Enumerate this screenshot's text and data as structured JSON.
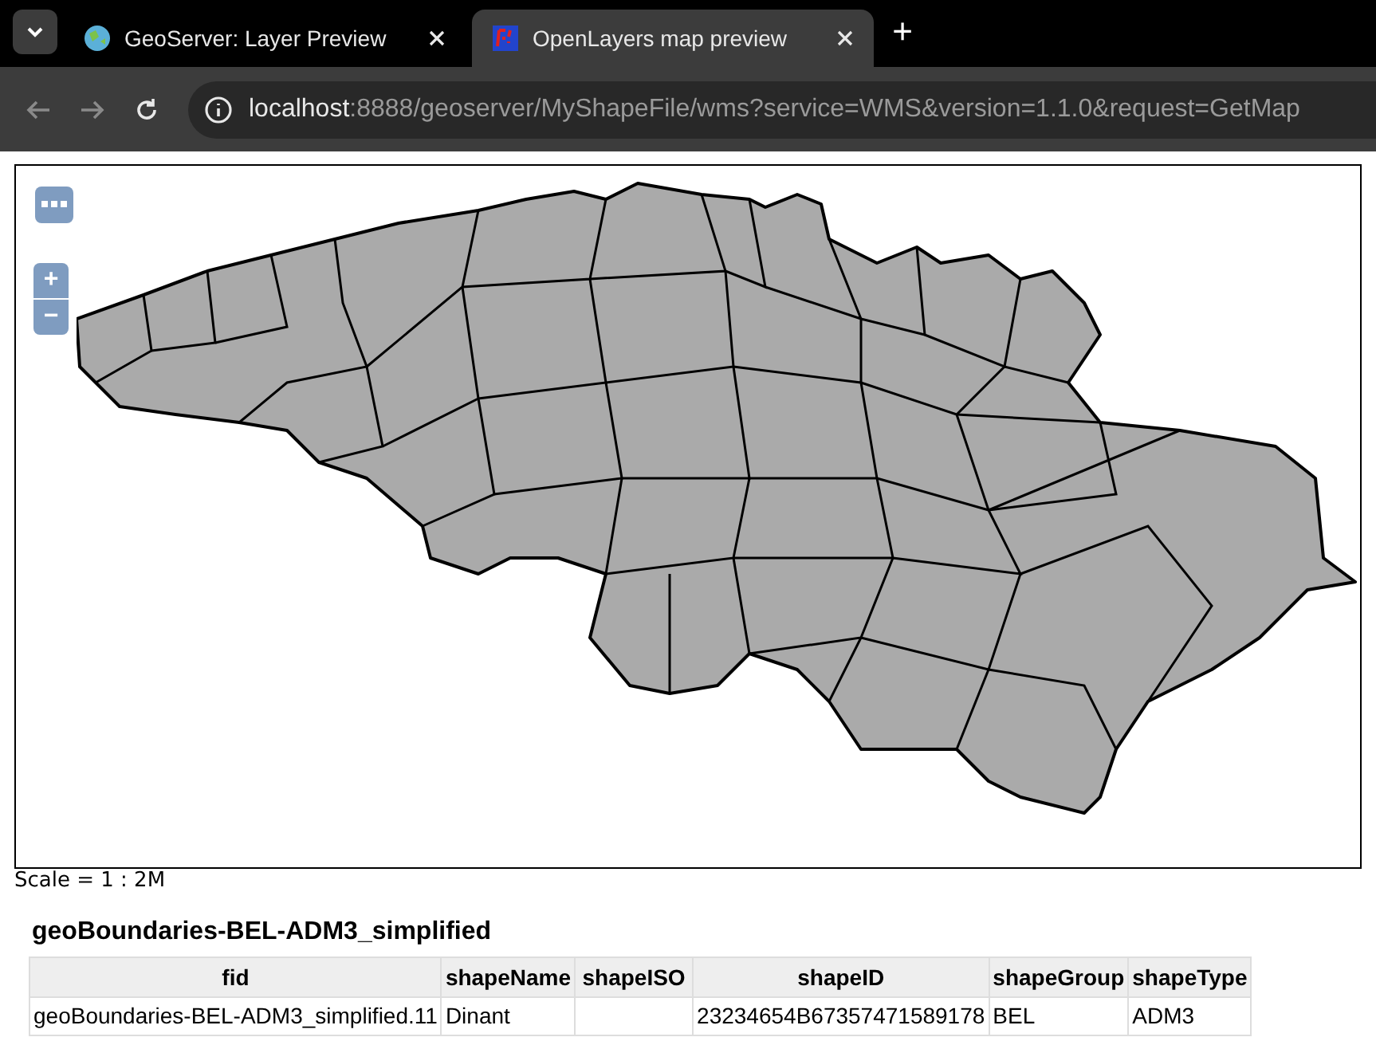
{
  "browser": {
    "tabs": [
      {
        "title": "GeoServer: Layer Preview",
        "selected": false
      },
      {
        "title": "OpenLayers map preview",
        "selected": true
      }
    ],
    "new_tab": "+",
    "address": {
      "host": "localhost",
      "rest": ":8888/geoserver/MyShapeFile/wms?service=WMS&version=1.1.0&request=GetMap"
    }
  },
  "map": {
    "zoom_in": "+",
    "zoom_out": "−"
  },
  "scale": "Scale = 1 : 2M",
  "layer_title": "geoBoundaries-BEL-ADM3_simplified",
  "table": {
    "columns": [
      "fid",
      "shapeName",
      "shapeISO",
      "shapeID",
      "shapeGroup",
      "shapeType"
    ],
    "rows": [
      [
        "geoBoundaries-BEL-ADM3_simplified.11",
        "Dinant",
        "",
        "23234654B67357471589178",
        "BEL",
        "ADM3"
      ]
    ]
  }
}
